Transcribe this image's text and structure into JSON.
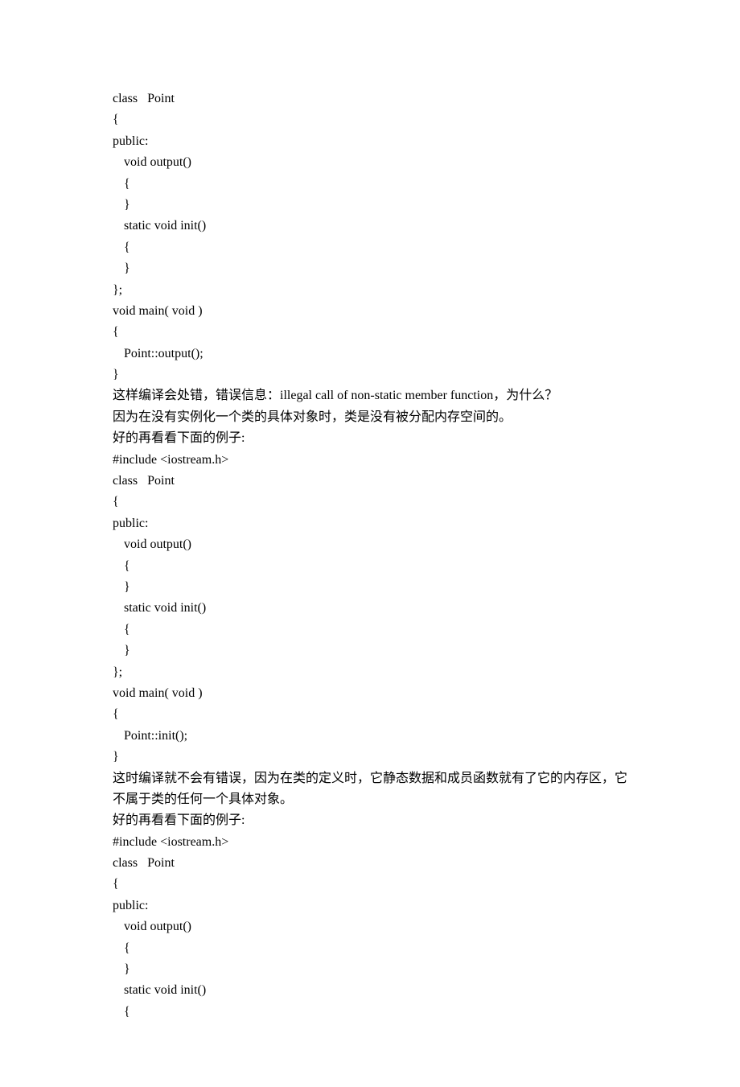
{
  "lines": [
    {
      "text": "class   Point",
      "indent": 0
    },
    {
      "text": "{",
      "indent": 0
    },
    {
      "text": "public:",
      "indent": 0
    },
    {
      "text": "void output()",
      "indent": 1
    },
    {
      "text": "{",
      "indent": 1
    },
    {
      "text": "}",
      "indent": 1
    },
    {
      "text": "static void init()",
      "indent": 1
    },
    {
      "text": "{",
      "indent": 1
    },
    {
      "text": "}",
      "indent": 1
    },
    {
      "text": "};",
      "indent": 0
    },
    {
      "text": "void main( void )",
      "indent": 0
    },
    {
      "text": "{",
      "indent": 0
    },
    {
      "text": "Point::output();",
      "indent": 1
    },
    {
      "text": "}",
      "indent": 0
    },
    {
      "text": "这样编译会处错，错误信息：illegal call of non-static member function，为什么？",
      "indent": 0
    },
    {
      "text": "因为在没有实例化一个类的具体对象时，类是没有被分配内存空间的。",
      "indent": 0
    },
    {
      "text": "好的再看看下面的例子:",
      "indent": 0
    },
    {
      "text": "#include <iostream.h>",
      "indent": 0
    },
    {
      "text": "class   Point",
      "indent": 0
    },
    {
      "text": "{",
      "indent": 0
    },
    {
      "text": "public:",
      "indent": 0
    },
    {
      "text": "void output()",
      "indent": 1
    },
    {
      "text": "{",
      "indent": 1
    },
    {
      "text": "}",
      "indent": 1
    },
    {
      "text": "static void init()",
      "indent": 1
    },
    {
      "text": "{",
      "indent": 1
    },
    {
      "text": "}",
      "indent": 1
    },
    {
      "text": "};",
      "indent": 0
    },
    {
      "text": "void main( void )",
      "indent": 0
    },
    {
      "text": "{",
      "indent": 0
    },
    {
      "text": "Point::init();",
      "indent": 1
    },
    {
      "text": "}",
      "indent": 0
    },
    {
      "text": "这时编译就不会有错误，因为在类的定义时，它静态数据和成员函数就有了它的内存区，它",
      "indent": 0
    },
    {
      "text": "不属于类的任何一个具体对象。",
      "indent": 0
    },
    {
      "text": "好的再看看下面的例子:",
      "indent": 0
    },
    {
      "text": "#include <iostream.h>",
      "indent": 0
    },
    {
      "text": "class   Point",
      "indent": 0
    },
    {
      "text": "{",
      "indent": 0
    },
    {
      "text": "public:",
      "indent": 0
    },
    {
      "text": "void output()",
      "indent": 1
    },
    {
      "text": "{",
      "indent": 1
    },
    {
      "text": "}",
      "indent": 1
    },
    {
      "text": "static void init()",
      "indent": 1
    },
    {
      "text": "{",
      "indent": 1
    }
  ]
}
